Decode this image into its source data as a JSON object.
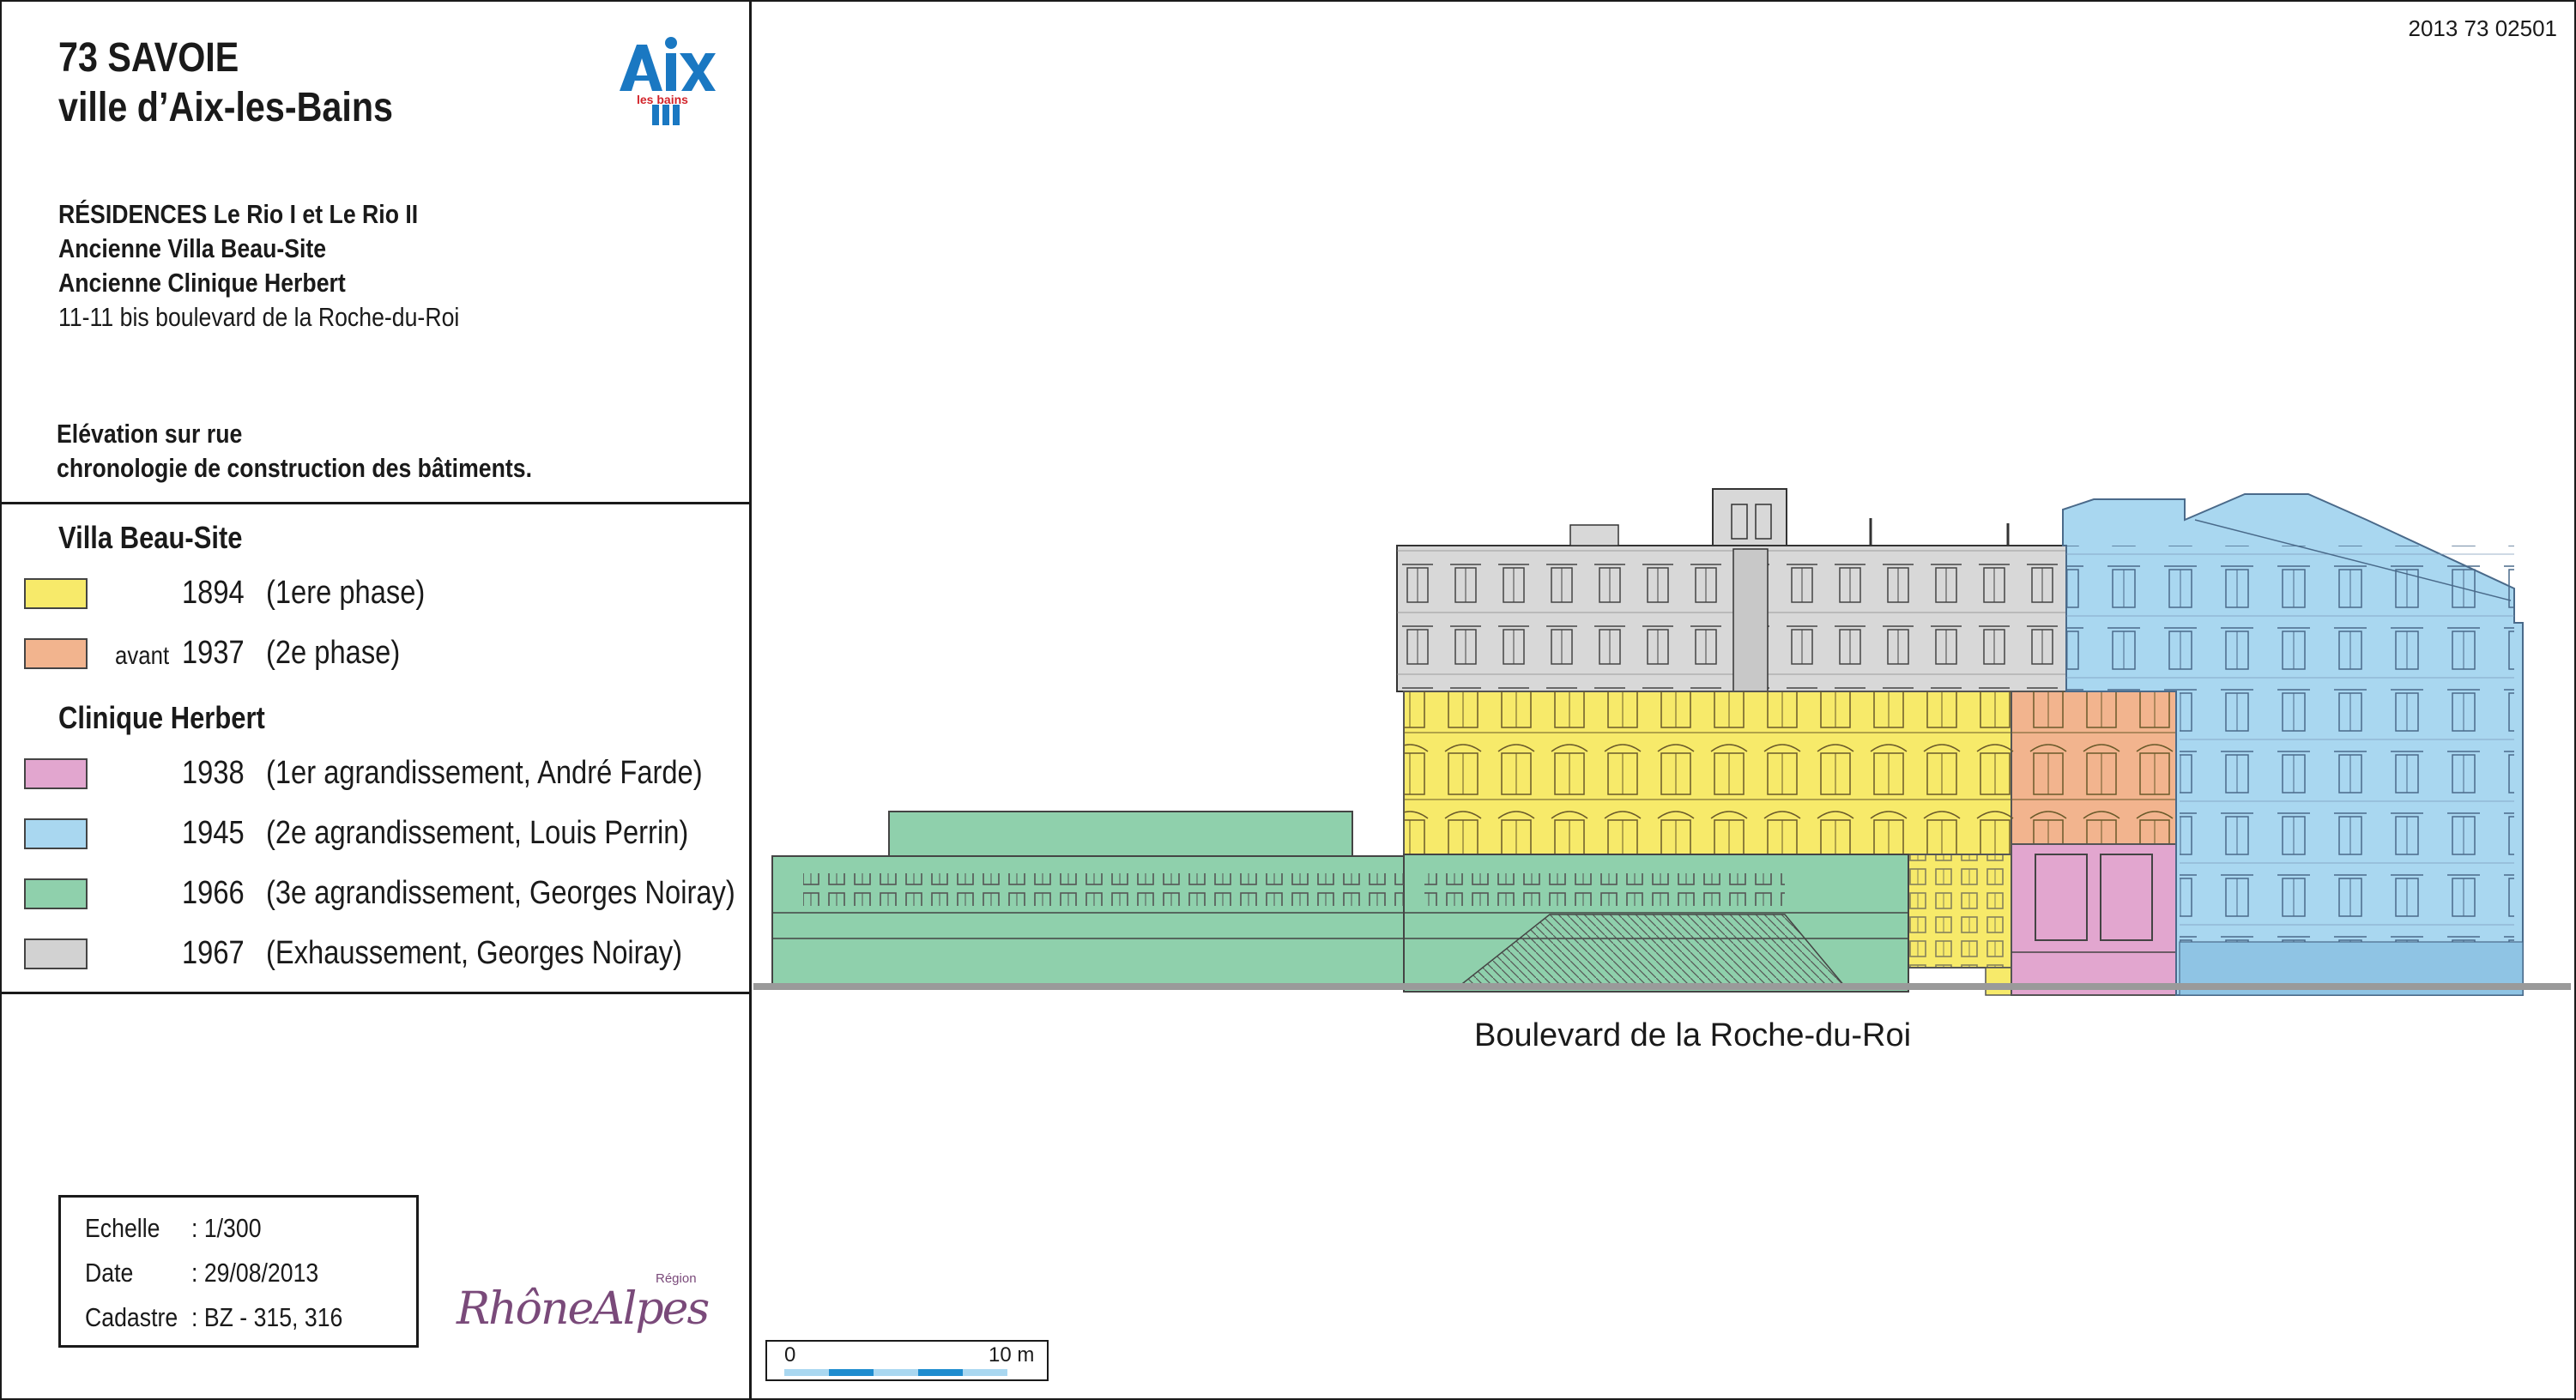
{
  "header": {
    "department": "73 SAVOIE",
    "city": "ville d’Aix-les-Bains",
    "logo_text": "Aix",
    "logo_subtext": "les bains"
  },
  "reference_code": "2013 73 02501",
  "building": {
    "line1": "RÉSIDENCES Le Rio I et Le Rio II",
    "line2": "Ancienne Villa Beau-Site",
    "line3": "Ancienne Clinique Herbert",
    "address": "11-11 bis boulevard de la Roche-du-Roi"
  },
  "drawing": {
    "line1": "Elévation sur rue",
    "line2": "chronologie de construction des bâtiments."
  },
  "legend": {
    "group1_title": "Villa Beau-Site",
    "group2_title": "Clinique Herbert",
    "items": [
      {
        "prefix": "",
        "year": "1894",
        "label": "(1ere phase)",
        "color": "#f7ea6a"
      },
      {
        "prefix": "avant",
        "year": "1937",
        "label": "(2e phase)",
        "color": "#f2b48e"
      },
      {
        "prefix": "",
        "year": "1938",
        "label": "(1er agrandissement, André Farde)",
        "color": "#e2a6cf"
      },
      {
        "prefix": "",
        "year": "1945",
        "label": "(2e agrandissement, Louis Perrin)",
        "color": "#a9d7f0"
      },
      {
        "prefix": "",
        "year": "1966",
        "label": "(3e agrandissement, Georges Noiray)",
        "color": "#8fd0ac"
      },
      {
        "prefix": "",
        "year": "1967",
        "label": "(Exhaussement, Georges Noiray)",
        "color": "#d2d2d2"
      }
    ]
  },
  "info": {
    "scale_label": "Echelle",
    "scale_value": ":  1/300",
    "date_label": "Date",
    "date_value": ":  29/08/2013",
    "cadastre_label": "Cadastre",
    "cadastre_value": ":  BZ - 315, 316"
  },
  "region_logo": {
    "text": "RhôneAlpes",
    "small": "Région"
  },
  "street_label": "Boulevard de la Roche-du-Roi",
  "scale_bar": {
    "start": "0",
    "end": "10 m"
  }
}
